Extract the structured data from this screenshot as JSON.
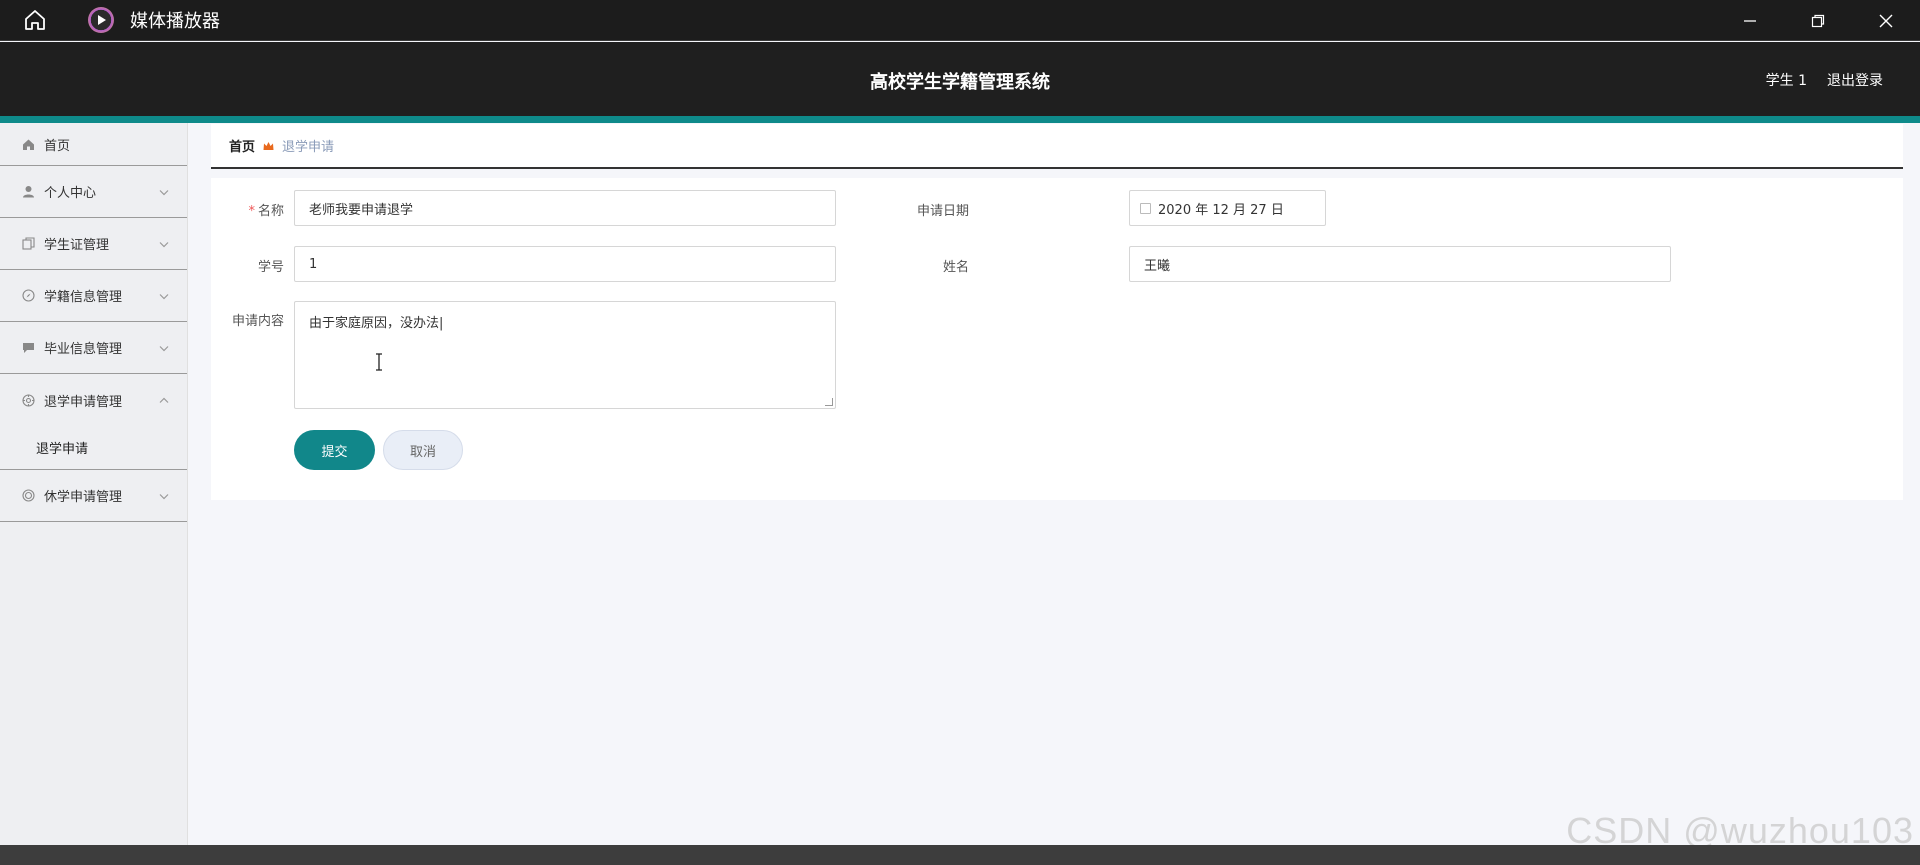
{
  "window": {
    "title": "媒体播放器",
    "icons": [
      "home-icon",
      "media-player-logo-icon",
      "minimize-icon",
      "restore-icon",
      "close-icon"
    ]
  },
  "header": {
    "system_title": "高校学生学籍管理系统",
    "user": "学生 1",
    "logout": "退出登录"
  },
  "colors": {
    "accent": "#0e8a8a",
    "header_bg": "#1f1f1f",
    "submit_bg": "#11878a"
  },
  "sidebar": {
    "items": [
      {
        "label": "首页",
        "icon": "home-icon"
      },
      {
        "label": "个人中心",
        "icon": "user-icon"
      },
      {
        "label": "学生证管理",
        "icon": "copy-icon"
      },
      {
        "label": "学籍信息管理",
        "icon": "compass-icon"
      },
      {
        "label": "毕业信息管理",
        "icon": "chat-icon"
      },
      {
        "label": "退学申请管理",
        "icon": "target-icon",
        "expanded": true
      },
      {
        "label": "休学申请管理",
        "icon": "circle-icon"
      }
    ],
    "sub_item": "退学申请"
  },
  "breadcrumb": {
    "home": "首页",
    "current": "退学申请"
  },
  "form": {
    "name_label": "名称",
    "name_value": "老师我要申请退学",
    "date_label": "申请日期",
    "date_value": "2020 年 12 月 27 日",
    "student_id_label": "学号",
    "student_id_value": "1",
    "student_name_label": "姓名",
    "student_name_value": "王曦",
    "content_label": "申请内容",
    "content_value": "由于家庭原因，没办法|",
    "submit_label": "提交",
    "cancel_label": "取消"
  },
  "watermark": "CSDN @wuzhou103"
}
